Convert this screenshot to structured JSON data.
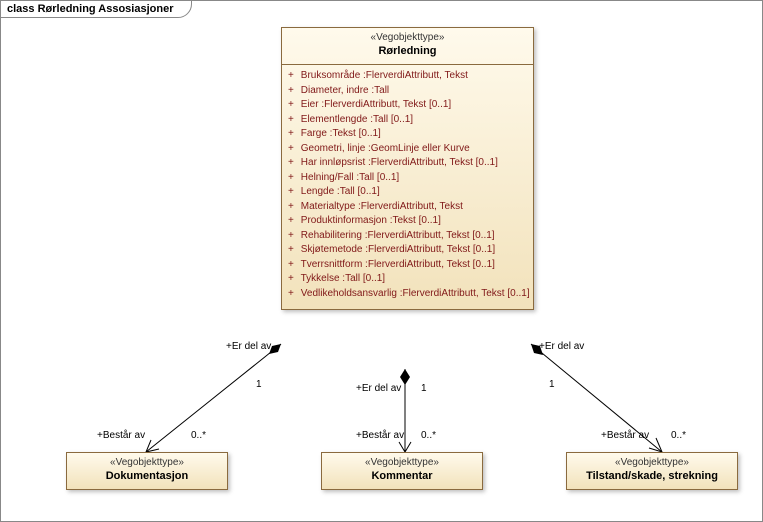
{
  "frame": {
    "title": "class Rørledning Assosiasjoner"
  },
  "main": {
    "stereo": "«Vegobjekttype»",
    "name": "Rørledning",
    "attrs": [
      "Bruksområde  :FlerverdiAttributt, Tekst",
      "Diameter, indre  :Tall",
      "Eier  :FlerverdiAttributt, Tekst [0..1]",
      "Elementlengde  :Tall [0..1]",
      "Farge  :Tekst [0..1]",
      "Geometri, linje  :GeomLinje eller Kurve",
      "Har innløpsrist  :FlerverdiAttributt, Tekst [0..1]",
      "Helning/Fall  :Tall [0..1]",
      "Lengde  :Tall [0..1]",
      "Materialtype  :FlerverdiAttributt, Tekst",
      "Produktinformasjon  :Tekst [0..1]",
      "Rehabilitering  :FlerverdiAttributt, Tekst [0..1]",
      "Skjøtemetode  :FlerverdiAttributt, Tekst [0..1]",
      "Tverrsnittform  :FlerverdiAttributt, Tekst [0..1]",
      "Tykkelse  :Tall [0..1]",
      "Vedlikeholdsansvarlig  :FlerverdiAttributt, Tekst [0..1]"
    ]
  },
  "children": [
    {
      "stereo": "«Vegobjekttype»",
      "name": "Dokumentasjon"
    },
    {
      "stereo": "«Vegobjekttype»",
      "name": "Kommentar"
    },
    {
      "stereo": "«Vegobjekttype»",
      "name": "Tilstand/skade, strekning"
    }
  ],
  "labels": {
    "parentRole": "+Er del av",
    "childRole": "+Består av",
    "one": "1",
    "many": "0..*"
  }
}
